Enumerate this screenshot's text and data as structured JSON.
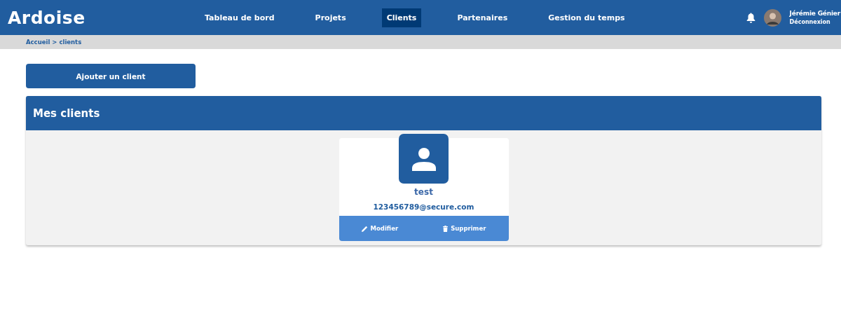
{
  "logo": "Ardoise",
  "nav": [
    {
      "label": "Tableau de bord",
      "selected": false
    },
    {
      "label": "Projets",
      "selected": false
    },
    {
      "label": "Clients",
      "selected": true
    },
    {
      "label": "Partenaires",
      "selected": false
    },
    {
      "label": "Gestion du temps",
      "selected": false
    }
  ],
  "user": {
    "name": "Jérémie Génier",
    "logout": "Déconnexion"
  },
  "breadcrumb": [
    "Accueil",
    ">",
    "clients"
  ],
  "add_button": "Ajouter un client",
  "panel": {
    "title": "Mes clients",
    "clients": [
      {
        "name": "test",
        "email": "123456789@secure.com",
        "edit": "Modifier",
        "delete": "Supprimer"
      }
    ]
  }
}
